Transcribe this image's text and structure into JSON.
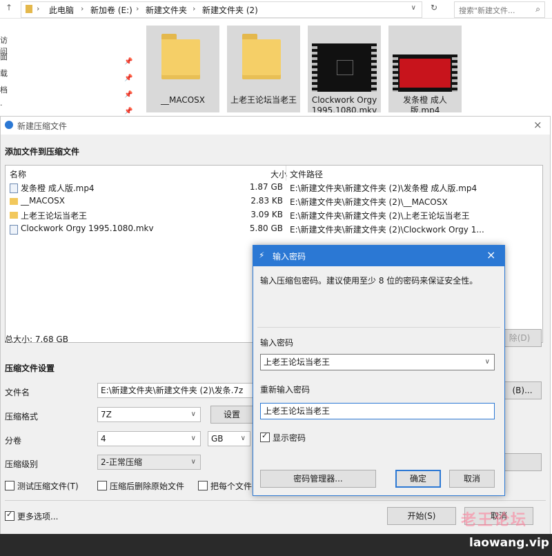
{
  "explorer": {
    "path": [
      "此电脑",
      "新加卷 (E:)",
      "新建文件夹",
      "新建文件夹 (2)"
    ],
    "search_placeholder": "搜索\"新建文件...",
    "nav_letters": [
      "访问",
      "面",
      "载",
      "档",
      "·"
    ],
    "items": [
      {
        "label": "__MACOSX",
        "type": "folder"
      },
      {
        "label": "上老王论坛当老王",
        "type": "folder"
      },
      {
        "label": "Clockwork Orgy 1995.1080.mkv",
        "type": "video"
      },
      {
        "label": "发条橙 成人版.mp4",
        "type": "video"
      }
    ]
  },
  "dialog": {
    "title": "新建压缩文件",
    "section_add": "添加文件到压缩文件",
    "columns": {
      "name": "名称",
      "size": "大小",
      "path": "文件路径"
    },
    "files": [
      {
        "name": "发条橙 成人版.mp4",
        "size": "1.87 GB",
        "path": "E:\\新建文件夹\\新建文件夹 (2)\\发条橙 成人版.mp4",
        "type": "file"
      },
      {
        "name": "__MACOSX",
        "size": "2.83 KB",
        "path": "E:\\新建文件夹\\新建文件夹 (2)\\__MACOSX",
        "type": "folder"
      },
      {
        "name": "上老王论坛当老王",
        "size": "3.09 KB",
        "path": "E:\\新建文件夹\\新建文件夹 (2)\\上老王论坛当老王",
        "type": "folder"
      },
      {
        "name": "Clockwork Orgy 1995.1080.mkv",
        "size": "5.80 GB",
        "path": "E:\\新建文件夹\\新建文件夹 (2)\\Clockwork Orgy 1...",
        "type": "file"
      }
    ],
    "total_size": "总大小: 7.68 GB",
    "delete_label": "除(D)",
    "section_settings": "压缩文件设置",
    "filename_label": "文件名",
    "filename_value": "E:\\新建文件夹\\新建文件夹 (2)\\发条.7z",
    "browse_label": "(B)...",
    "format_label": "压缩格式",
    "format_value": "7Z",
    "settings_label": "设置",
    "split_label": "分卷",
    "split_value": "4",
    "split_unit": "GB",
    "level_label": "压缩级别",
    "level_value": "2-正常压缩",
    "test_label": "测试压缩文件(T)",
    "delete_after_label": "压缩后删除原始文件",
    "each_file_label": "把每个文件",
    "more_options_label": "更多选项...",
    "start_label": "开始(S)",
    "cancel_label": "取消"
  },
  "password": {
    "title": "输入密码",
    "hint": "输入压缩包密码。建议使用至少 8 位的密码来保证安全性。",
    "enter_label": "输入密码",
    "enter_value": "上老王论坛当老王",
    "reenter_label": "重新输入密码",
    "reenter_value": "上老王论坛当老王",
    "show_label": "显示密码",
    "manager_label": "密码管理器...",
    "ok_label": "确定",
    "cancel_label": "取消"
  },
  "watermark": {
    "cn": "老王论坛",
    "url": "laowang.vip"
  }
}
